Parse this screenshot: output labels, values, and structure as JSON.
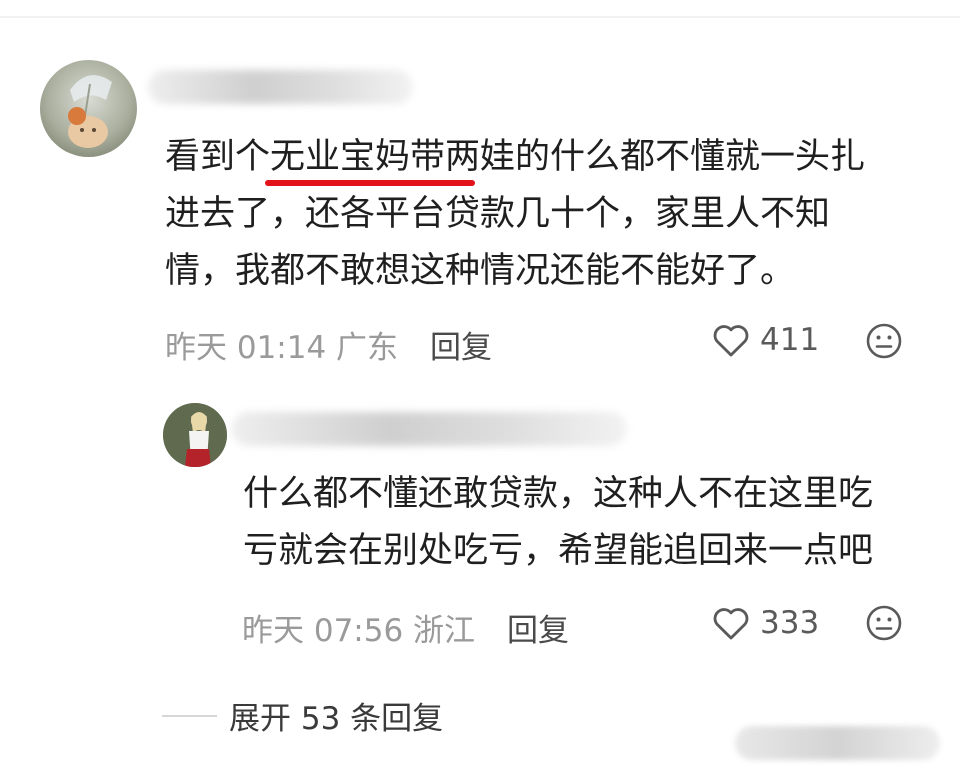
{
  "comments": [
    {
      "author_name": "",
      "text": "看到个无业宝妈带两娃的什么都不懂就一头扎\n进去了，还各平台贷款几十个，家里人不知\n情，我都不敢想这种情况还能不能好了。",
      "time": "昨天 01:14 广东",
      "reply_label": "回复",
      "likes": "411",
      "highlight_color": "#e3121a"
    },
    {
      "author_name": "",
      "text": "什么都不懂还敢贷款，这种人不在这里吃\n亏就会在别处吃亏，希望能追回来一点吧",
      "time": "昨天 07:56 浙江",
      "reply_label": "回复",
      "likes": "333"
    }
  ],
  "expand_replies_label": "展开 53 条回复",
  "icons": {
    "like": "heart-outline-icon",
    "emoji": "neutral-face-icon"
  }
}
